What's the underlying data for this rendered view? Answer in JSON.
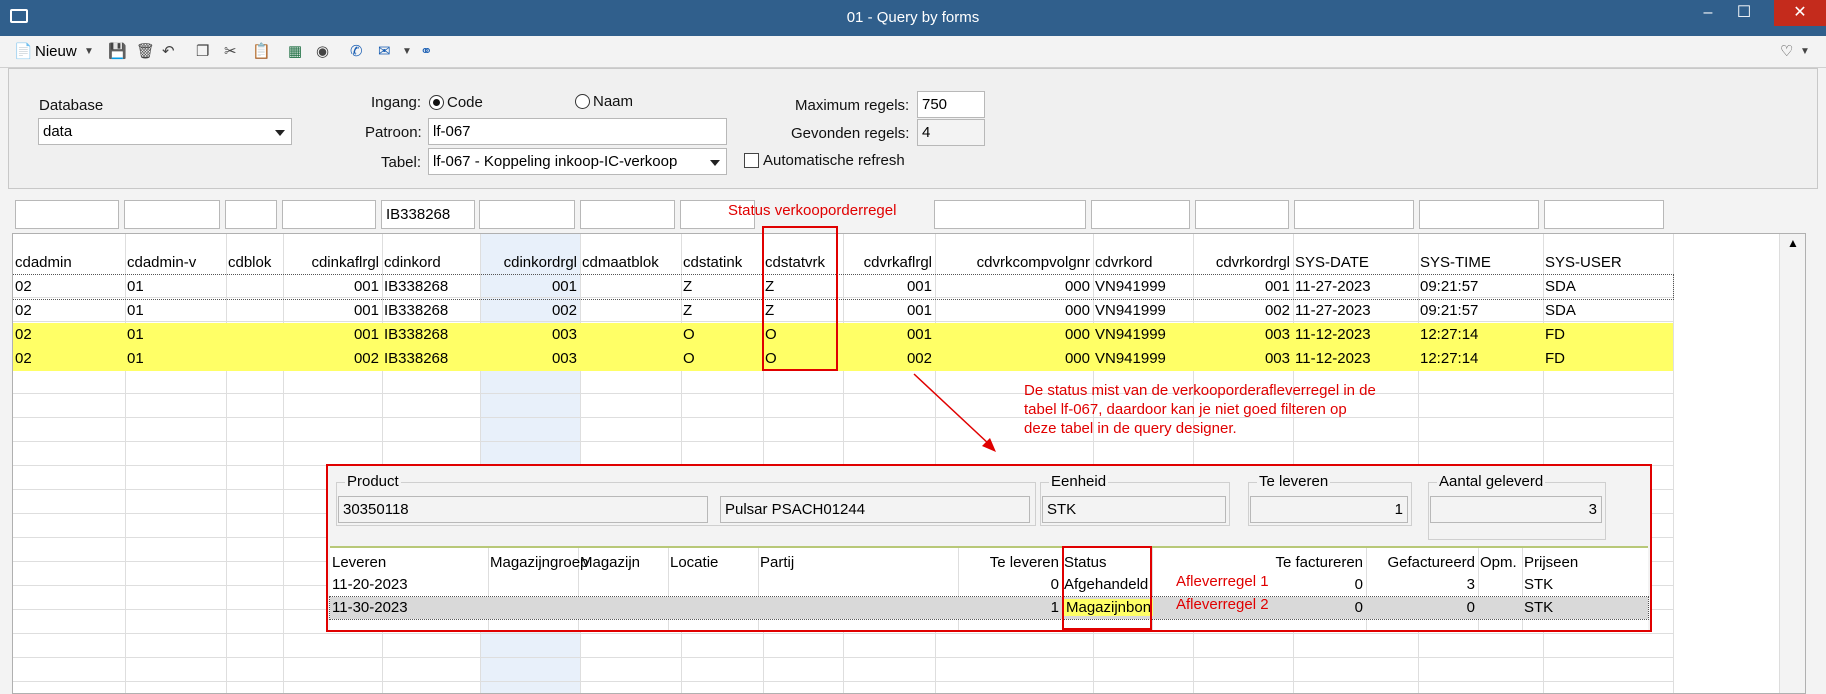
{
  "window": {
    "title": "01 - Query by forms"
  },
  "toolbar": {
    "new_label": "Nieuw"
  },
  "form": {
    "database_label": "Database",
    "database_value": "data",
    "ingang_label": "Ingang:",
    "radio_code": "Code",
    "radio_naam": "Naam",
    "patroon_label": "Patroon:",
    "patroon_value": "lf-067",
    "tabel_label": "Tabel:",
    "tabel_value": "lf-067 - Koppeling inkoop-IC-verkoop",
    "auto_refresh_label": "Automatische refresh",
    "max_label": "Maximum regels:",
    "max_value": "750",
    "found_label": "Gevonden regels:",
    "found_value": "4"
  },
  "filter": {
    "cdinkord": "IB338268"
  },
  "grid": {
    "headers": [
      "cdadmin",
      "cdadmin-v",
      "cdblok",
      "cdinkaflrgl",
      "cdinkord",
      "cdinkordrgl",
      "cdmaatblok",
      "cdstatink",
      "cdstatvrk",
      "cdvrkaflrgl",
      "cdvrkcompvolgnr",
      "cdvrkord",
      "cdvrkordrgl",
      "SYS-DATE",
      "SYS-TIME",
      "SYS-USER"
    ],
    "rows": [
      [
        "02",
        "01",
        "",
        "001",
        "IB338268",
        "001",
        "",
        "Z",
        "Z",
        "001",
        "000",
        "VN941999",
        "001",
        "11-27-2023",
        "09:21:57",
        "SDA"
      ],
      [
        "02",
        "01",
        "",
        "001",
        "IB338268",
        "002",
        "",
        "Z",
        "Z",
        "001",
        "000",
        "VN941999",
        "002",
        "11-27-2023",
        "09:21:57",
        "SDA"
      ],
      [
        "02",
        "01",
        "",
        "001",
        "IB338268",
        "003",
        "",
        "O",
        "O",
        "001",
        "000",
        "VN941999",
        "003",
        "11-12-2023",
        "12:27:14",
        "FD"
      ],
      [
        "02",
        "01",
        "",
        "002",
        "IB338268",
        "003",
        "",
        "O",
        "O",
        "002",
        "000",
        "VN941999",
        "003",
        "11-12-2023",
        "12:27:14",
        "FD"
      ]
    ]
  },
  "annotations": {
    "status_label": "Status verkooporderregel",
    "note_line1": "De status mist van de verkooporderafleverregel in de",
    "note_line2": "tabel lf-067, daardoor kan je niet goed filteren op",
    "note_line3": "deze tabel in de query designer.",
    "aflever1": "Afleverregel 1",
    "aflever2": "Afleverregel 2"
  },
  "detail": {
    "product_label": "Product",
    "product_code": "30350118",
    "product_name": "Pulsar PSACH01244",
    "eenheid_label": "Eenheid",
    "eenheid_value": "STK",
    "te_leveren_label": "Te leveren",
    "te_leveren_value": "1",
    "aantal_label": "Aantal geleverd",
    "aantal_value": "3",
    "headers": [
      "Leveren",
      "Magazijngroep",
      "Magazijn",
      "Locatie",
      "Partij",
      "Te leveren",
      "Status",
      "Te factureren",
      "Gefactureerd",
      "Opm.",
      "Prijseen"
    ],
    "rows": [
      [
        "11-20-2023",
        "",
        "",
        "",
        "",
        "0",
        "Afgehandeld",
        "0",
        "3",
        "",
        "STK"
      ],
      [
        "11-30-2023",
        "",
        "",
        "",
        "",
        "1",
        "Magazijnbon",
        "0",
        "0",
        "",
        "STK"
      ]
    ]
  },
  "colors": {
    "titlebar": "#305f8c",
    "highlight": "#ffff66",
    "annotation": "#e00000"
  }
}
